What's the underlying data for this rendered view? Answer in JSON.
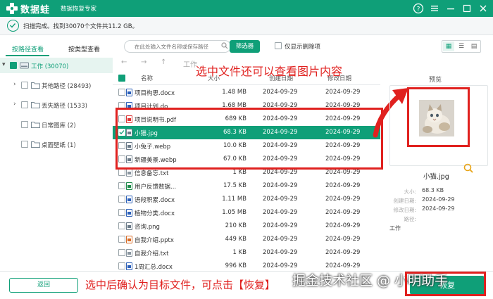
{
  "app": {
    "name": "数据蛙",
    "subtitle": "数据恢复专家"
  },
  "status": {
    "text": "扫描完成。找到30070个文件共11.2 GB。"
  },
  "left_tabs": [
    "按路径查看",
    "按类型查看"
  ],
  "tree": [
    {
      "label": "工作 (30070)"
    },
    {
      "label": "其他路径 (28493)"
    },
    {
      "label": "丢失路径 (1533)"
    },
    {
      "label": "日常图库 (2)"
    },
    {
      "label": "桌面壁纸 (1)"
    }
  ],
  "toolbar": {
    "search_placeholder": "在此处输入文件名称或保存路径",
    "filter_label": "筛选器",
    "only_deleted_label": "仅显示删除项"
  },
  "path": {
    "label": "工作"
  },
  "table": {
    "headers": [
      "名称",
      "大小",
      "创建日期",
      "修改日期"
    ],
    "rows": [
      {
        "name": "项目构思.docx",
        "size": "1.48 MB",
        "created": "2024-09-29",
        "modified": "2024-09-29",
        "icon": "word-icon"
      },
      {
        "name": "项目计划.do",
        "size": "1.68 MB",
        "created": "2024-09-29",
        "modified": "2024-09-29",
        "icon": "word-icon"
      },
      {
        "name": "项目说明书.pdf",
        "size": "689 KB",
        "created": "2024-09-29",
        "modified": "2024-09-29",
        "icon": "pdf-icon"
      },
      {
        "name": "小猫.jpg",
        "size": "68.3 KB",
        "created": "2024-09-29",
        "modified": "2024-09-29",
        "icon": "image-icon"
      },
      {
        "name": "小兔子.webp",
        "size": "10.0 KB",
        "created": "2024-09-29",
        "modified": "2024-09-29",
        "icon": "image-icon"
      },
      {
        "name": "新疆美景.webp",
        "size": "67.0 KB",
        "created": "2024-09-29",
        "modified": "2024-09-29",
        "icon": "image-icon"
      },
      {
        "name": "信息备忘.txt",
        "size": "1 KB",
        "created": "2024-09-29",
        "modified": "2024-09-29",
        "icon": "text-icon"
      },
      {
        "name": "用户反馈数据...",
        "size": "17.5 KB",
        "created": "2024-09-29",
        "modified": "2024-09-29",
        "icon": "excel-icon"
      },
      {
        "name": "语段积累.docx",
        "size": "1.11 MB",
        "created": "2024-09-29",
        "modified": "2024-09-29",
        "icon": "word-icon"
      },
      {
        "name": "植物分类.docx",
        "size": "1.05 MB",
        "created": "2024-09-29",
        "modified": "2024-09-29",
        "icon": "word-icon"
      },
      {
        "name": "咨询.png",
        "size": "210 KB",
        "created": "2024-09-29",
        "modified": "2024-09-29",
        "icon": "image-icon"
      },
      {
        "name": "自我介绍.pptx",
        "size": "449 KB",
        "created": "2024-09-29",
        "modified": "2024-09-29",
        "icon": "ppt-icon"
      },
      {
        "name": "自我介绍.txt",
        "size": "1 KB",
        "created": "2024-09-29",
        "modified": "2024-09-29",
        "icon": "text-icon"
      },
      {
        "name": "1周汇总.docx",
        "size": "996 KB",
        "created": "2024-09-29",
        "modified": "2024-09-29",
        "icon": "word-icon"
      }
    ]
  },
  "preview": {
    "title": "预览",
    "file_name": "小猫.jpg",
    "fields": [
      {
        "key": "大小:",
        "value": "68.3 KB"
      },
      {
        "key": "创建日期:",
        "value": "2024-09-29"
      },
      {
        "key": "修改日期:",
        "value": "2024-09-29"
      },
      {
        "key": "路径:",
        "value": ""
      }
    ],
    "path_value": "工作"
  },
  "footer": {
    "back_label": "返回",
    "recover_label": "恢复"
  },
  "annotations": {
    "top": "选中文件还可以查看图片内容",
    "bottom": "选中后确认为目标文件，可点击【恢复】",
    "watermark": "掘金技术社区 @ 小明助手"
  },
  "colors": {
    "accent": "#0f9f78",
    "annotation_red": "#e0211f"
  }
}
